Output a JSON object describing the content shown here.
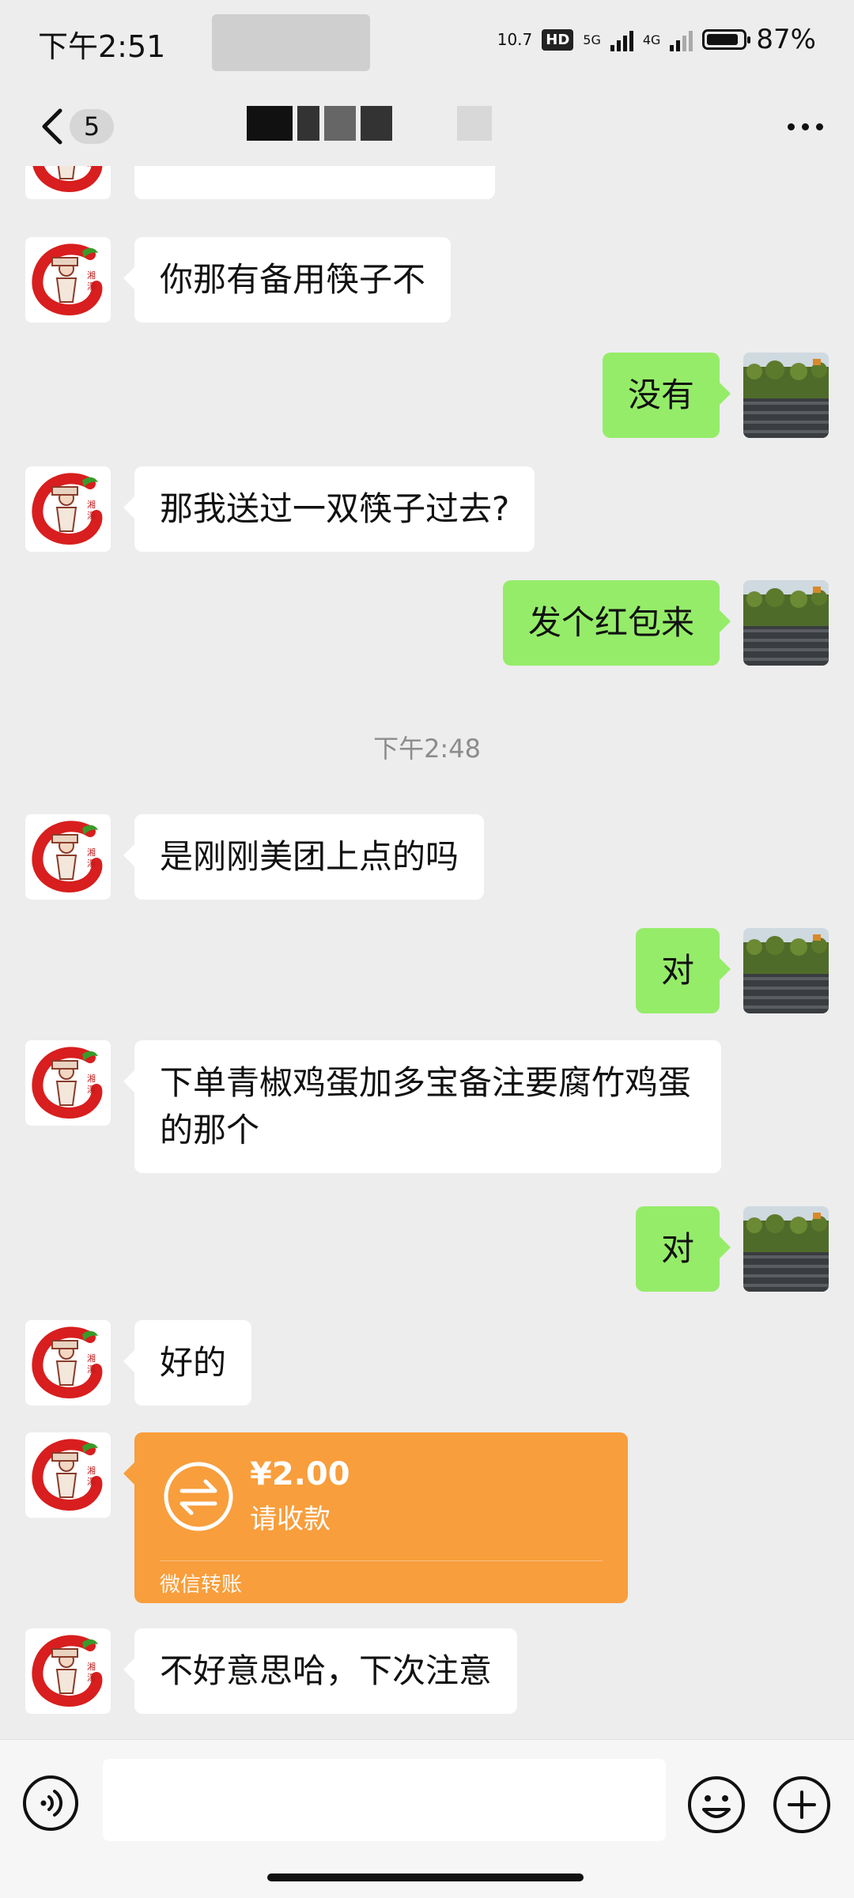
{
  "status_bar": {
    "time": "下午2:51",
    "net_speed_top": "10.7",
    "net_speed_bottom": "",
    "hd_label": "HD",
    "net1": "5G",
    "net2": "4G",
    "battery_percent": "87%",
    "battery_level": 0.87
  },
  "nav": {
    "back_icon": "chevron-left-icon",
    "unread_count": "5",
    "more_icon": "more-dots-icon"
  },
  "messages": [
    {
      "side": "left",
      "text": "你那有备用筷子不"
    },
    {
      "side": "right",
      "text": "没有"
    },
    {
      "side": "left",
      "text": "那我送过一双筷子过去?"
    },
    {
      "side": "right",
      "text": "发个红包来"
    },
    {
      "timestamp": "下午2:48"
    },
    {
      "side": "left",
      "text": "是刚刚美团上点的吗"
    },
    {
      "side": "right",
      "text": "对"
    },
    {
      "side": "left",
      "text": "下单青椒鸡蛋加多宝备注要腐竹鸡蛋的那个"
    },
    {
      "side": "right",
      "text": "对"
    },
    {
      "side": "left",
      "text": "好的"
    },
    {
      "side": "left",
      "type": "transfer",
      "amount": "¥2.00",
      "status": "请收款",
      "footer": "微信转账"
    },
    {
      "side": "left",
      "text": "不好意思哈，下次注意"
    }
  ],
  "input_bar": {
    "voice_icon": "voice-icon",
    "input_value": "",
    "emoji_icon": "emoji-icon",
    "plus_icon": "plus-icon"
  },
  "colors": {
    "background": "#ededed",
    "self_bubble": "#95ec69",
    "other_bubble": "#ffffff",
    "transfer_card": "#f89e3c"
  }
}
